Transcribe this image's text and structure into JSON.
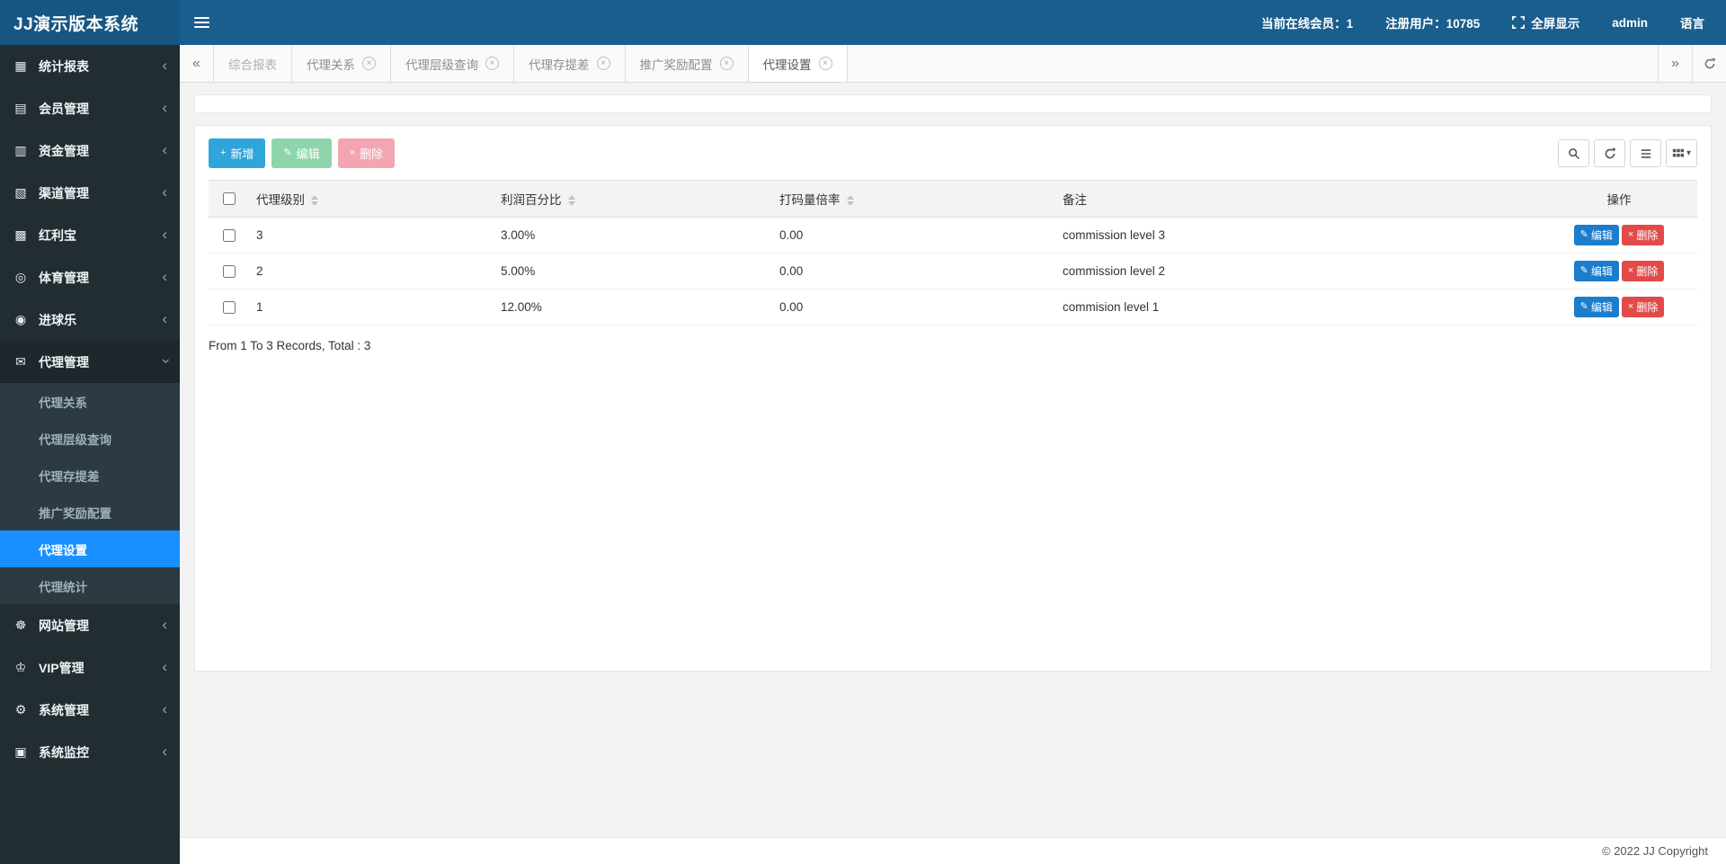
{
  "colors": {
    "header_bg": "#1a5e8e",
    "brand_bg": "#175682",
    "sidebar_bg": "#222d32",
    "submenu_bg": "#2c3b41",
    "active_item_bg": "#1890ff",
    "add_btn": "#30a5dc",
    "edit_btn_disabled": "#8fd5ac",
    "delete_btn_disabled": "#f3a6b2",
    "row_edit_btn": "#1b7dcc",
    "row_delete_btn": "#e24a4a",
    "tabbar_bg": "#fafafa",
    "content_bg": "#f3f3f4"
  },
  "header": {
    "brand": "JJ演示版本系统",
    "online_label": "当前在线会员：1",
    "registered_label": "注册用户：10785",
    "fullscreen_label": "全屏显示",
    "admin_label": "admin",
    "language_label": "语言"
  },
  "sidebar": {
    "items": [
      {
        "label": "统计报表",
        "icon": "bar-chart",
        "glyph": "▦"
      },
      {
        "label": "会员管理",
        "icon": "members",
        "glyph": "▤"
      },
      {
        "label": "资金管理",
        "icon": "funds",
        "glyph": "▥"
      },
      {
        "label": "渠道管理",
        "icon": "channels",
        "glyph": "▧"
      },
      {
        "label": "红利宝",
        "icon": "bonus",
        "glyph": "▩"
      },
      {
        "label": "体育管理",
        "icon": "sports",
        "glyph": "◎"
      },
      {
        "label": "进球乐",
        "icon": "soccer",
        "glyph": "◉"
      },
      {
        "label": "代理管理",
        "icon": "envelope",
        "glyph": "✉",
        "expanded": true
      },
      {
        "label": "网站管理",
        "icon": "site-gears",
        "glyph": "☸"
      },
      {
        "label": "VIP管理",
        "icon": "vip-user",
        "glyph": "♔"
      },
      {
        "label": "系统管理",
        "icon": "gear",
        "glyph": "⚙"
      },
      {
        "label": "系统监控",
        "icon": "monitor",
        "glyph": "▣"
      }
    ],
    "agent_submenu": [
      {
        "label": "代理关系"
      },
      {
        "label": "代理层级查询"
      },
      {
        "label": "代理存提差"
      },
      {
        "label": "推广奖励配置"
      },
      {
        "label": "代理设置",
        "active": true
      },
      {
        "label": "代理统计"
      }
    ]
  },
  "tabs": {
    "items": [
      {
        "label": "综合报表",
        "closable": false
      },
      {
        "label": "代理关系",
        "closable": true
      },
      {
        "label": "代理层级查询",
        "closable": true
      },
      {
        "label": "代理存提差",
        "closable": true
      },
      {
        "label": "推广奖励配置",
        "closable": true
      },
      {
        "label": "代理设置",
        "closable": true,
        "active": true
      }
    ]
  },
  "toolbar": {
    "add_label": "新增",
    "edit_label": "编辑",
    "delete_label": "删除"
  },
  "table": {
    "columns": [
      "代理级别",
      "利润百分比",
      "打码量倍率",
      "备注",
      "操作"
    ],
    "rows": [
      {
        "level": "3",
        "profit": "3.00%",
        "rate": "0.00",
        "remark": "commission level 3"
      },
      {
        "level": "2",
        "profit": "5.00%",
        "rate": "0.00",
        "remark": "commission level 2"
      },
      {
        "level": "1",
        "profit": "12.00%",
        "rate": "0.00",
        "remark": "commision level 1"
      }
    ],
    "row_edit_label": "编辑",
    "row_delete_label": "删除",
    "summary": "From 1 To 3 Records, Total : 3"
  },
  "footer": {
    "copyright": "© 2022 JJ Copyright"
  },
  "icons": {
    "add_glyph": "+",
    "edit_glyph": "✎",
    "delete_glyph": "×",
    "close_glyph": "×",
    "chevron": "‹",
    "caret_down": "▾",
    "scroll_left": "«",
    "scroll_right": "»"
  }
}
